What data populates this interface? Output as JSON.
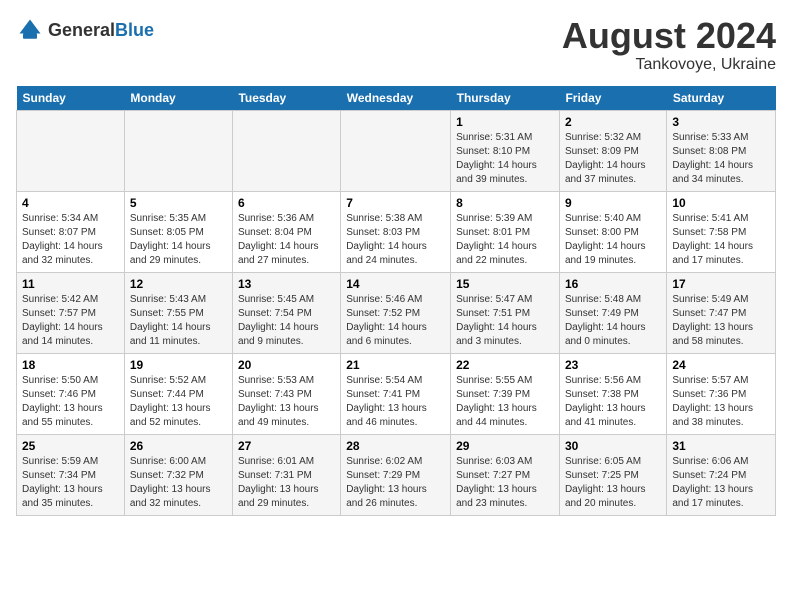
{
  "logo": {
    "general": "General",
    "blue": "Blue"
  },
  "title": {
    "month_year": "August 2024",
    "location": "Tankovoye, Ukraine"
  },
  "days_of_week": [
    "Sunday",
    "Monday",
    "Tuesday",
    "Wednesday",
    "Thursday",
    "Friday",
    "Saturday"
  ],
  "weeks": [
    [
      {
        "day": "",
        "info": ""
      },
      {
        "day": "",
        "info": ""
      },
      {
        "day": "",
        "info": ""
      },
      {
        "day": "",
        "info": ""
      },
      {
        "day": "1",
        "info": "Sunrise: 5:31 AM\nSunset: 8:10 PM\nDaylight: 14 hours\nand 39 minutes."
      },
      {
        "day": "2",
        "info": "Sunrise: 5:32 AM\nSunset: 8:09 PM\nDaylight: 14 hours\nand 37 minutes."
      },
      {
        "day": "3",
        "info": "Sunrise: 5:33 AM\nSunset: 8:08 PM\nDaylight: 14 hours\nand 34 minutes."
      }
    ],
    [
      {
        "day": "4",
        "info": "Sunrise: 5:34 AM\nSunset: 8:07 PM\nDaylight: 14 hours\nand 32 minutes."
      },
      {
        "day": "5",
        "info": "Sunrise: 5:35 AM\nSunset: 8:05 PM\nDaylight: 14 hours\nand 29 minutes."
      },
      {
        "day": "6",
        "info": "Sunrise: 5:36 AM\nSunset: 8:04 PM\nDaylight: 14 hours\nand 27 minutes."
      },
      {
        "day": "7",
        "info": "Sunrise: 5:38 AM\nSunset: 8:03 PM\nDaylight: 14 hours\nand 24 minutes."
      },
      {
        "day": "8",
        "info": "Sunrise: 5:39 AM\nSunset: 8:01 PM\nDaylight: 14 hours\nand 22 minutes."
      },
      {
        "day": "9",
        "info": "Sunrise: 5:40 AM\nSunset: 8:00 PM\nDaylight: 14 hours\nand 19 minutes."
      },
      {
        "day": "10",
        "info": "Sunrise: 5:41 AM\nSunset: 7:58 PM\nDaylight: 14 hours\nand 17 minutes."
      }
    ],
    [
      {
        "day": "11",
        "info": "Sunrise: 5:42 AM\nSunset: 7:57 PM\nDaylight: 14 hours\nand 14 minutes."
      },
      {
        "day": "12",
        "info": "Sunrise: 5:43 AM\nSunset: 7:55 PM\nDaylight: 14 hours\nand 11 minutes."
      },
      {
        "day": "13",
        "info": "Sunrise: 5:45 AM\nSunset: 7:54 PM\nDaylight: 14 hours\nand 9 minutes."
      },
      {
        "day": "14",
        "info": "Sunrise: 5:46 AM\nSunset: 7:52 PM\nDaylight: 14 hours\nand 6 minutes."
      },
      {
        "day": "15",
        "info": "Sunrise: 5:47 AM\nSunset: 7:51 PM\nDaylight: 14 hours\nand 3 minutes."
      },
      {
        "day": "16",
        "info": "Sunrise: 5:48 AM\nSunset: 7:49 PM\nDaylight: 14 hours\nand 0 minutes."
      },
      {
        "day": "17",
        "info": "Sunrise: 5:49 AM\nSunset: 7:47 PM\nDaylight: 13 hours\nand 58 minutes."
      }
    ],
    [
      {
        "day": "18",
        "info": "Sunrise: 5:50 AM\nSunset: 7:46 PM\nDaylight: 13 hours\nand 55 minutes."
      },
      {
        "day": "19",
        "info": "Sunrise: 5:52 AM\nSunset: 7:44 PM\nDaylight: 13 hours\nand 52 minutes."
      },
      {
        "day": "20",
        "info": "Sunrise: 5:53 AM\nSunset: 7:43 PM\nDaylight: 13 hours\nand 49 minutes."
      },
      {
        "day": "21",
        "info": "Sunrise: 5:54 AM\nSunset: 7:41 PM\nDaylight: 13 hours\nand 46 minutes."
      },
      {
        "day": "22",
        "info": "Sunrise: 5:55 AM\nSunset: 7:39 PM\nDaylight: 13 hours\nand 44 minutes."
      },
      {
        "day": "23",
        "info": "Sunrise: 5:56 AM\nSunset: 7:38 PM\nDaylight: 13 hours\nand 41 minutes."
      },
      {
        "day": "24",
        "info": "Sunrise: 5:57 AM\nSunset: 7:36 PM\nDaylight: 13 hours\nand 38 minutes."
      }
    ],
    [
      {
        "day": "25",
        "info": "Sunrise: 5:59 AM\nSunset: 7:34 PM\nDaylight: 13 hours\nand 35 minutes."
      },
      {
        "day": "26",
        "info": "Sunrise: 6:00 AM\nSunset: 7:32 PM\nDaylight: 13 hours\nand 32 minutes."
      },
      {
        "day": "27",
        "info": "Sunrise: 6:01 AM\nSunset: 7:31 PM\nDaylight: 13 hours\nand 29 minutes."
      },
      {
        "day": "28",
        "info": "Sunrise: 6:02 AM\nSunset: 7:29 PM\nDaylight: 13 hours\nand 26 minutes."
      },
      {
        "day": "29",
        "info": "Sunrise: 6:03 AM\nSunset: 7:27 PM\nDaylight: 13 hours\nand 23 minutes."
      },
      {
        "day": "30",
        "info": "Sunrise: 6:05 AM\nSunset: 7:25 PM\nDaylight: 13 hours\nand 20 minutes."
      },
      {
        "day": "31",
        "info": "Sunrise: 6:06 AM\nSunset: 7:24 PM\nDaylight: 13 hours\nand 17 minutes."
      }
    ]
  ]
}
